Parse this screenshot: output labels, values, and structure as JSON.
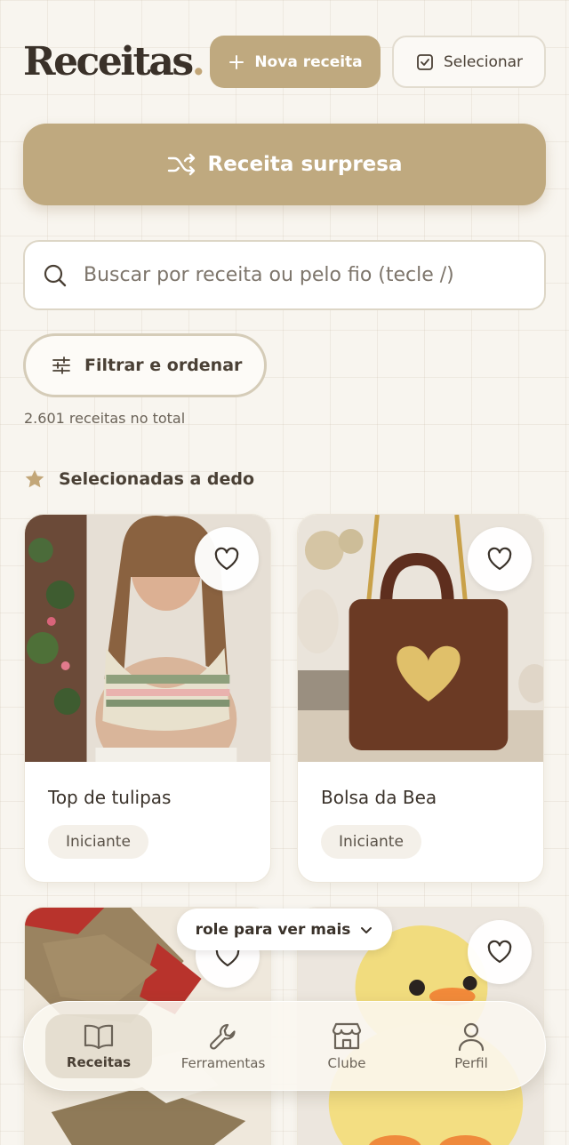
{
  "header": {
    "title": "Receitas",
    "title_dot": ".",
    "new_recipe_label": "Nova receita",
    "select_label": "Selecionar"
  },
  "surprise": {
    "label": "Receita surpresa"
  },
  "search": {
    "placeholder": "Buscar por receita ou pelo fio (tecle /)",
    "value": ""
  },
  "filter": {
    "label": "Filtrar e ordenar"
  },
  "count_text": "2.601 receitas no total",
  "section": {
    "title": "Selecionadas a dedo"
  },
  "cards": [
    {
      "title": "Top de tulipas",
      "level": "Iniciante",
      "image": "crochet-tulip-top-photo"
    },
    {
      "title": "Bolsa da Bea",
      "level": "Iniciante",
      "image": "crochet-heart-bag-photo"
    },
    {
      "title": "",
      "level": "",
      "image": "crochet-doily-photo"
    },
    {
      "title": "",
      "level": "",
      "image": "amigurumi-duck-photo"
    }
  ],
  "scroll_hint": {
    "label": "role para ver mais"
  },
  "tabbar": {
    "items": [
      {
        "label": "Receitas",
        "icon": "book-icon",
        "active": true
      },
      {
        "label": "Ferramentas",
        "icon": "wrench-icon",
        "active": false
      },
      {
        "label": "Clube",
        "icon": "store-icon",
        "active": false
      },
      {
        "label": "Perfil",
        "icon": "user-icon",
        "active": false
      }
    ]
  },
  "colors": {
    "accent": "#bfa97f",
    "background": "#f8f5ef",
    "text": "#3a322a"
  }
}
